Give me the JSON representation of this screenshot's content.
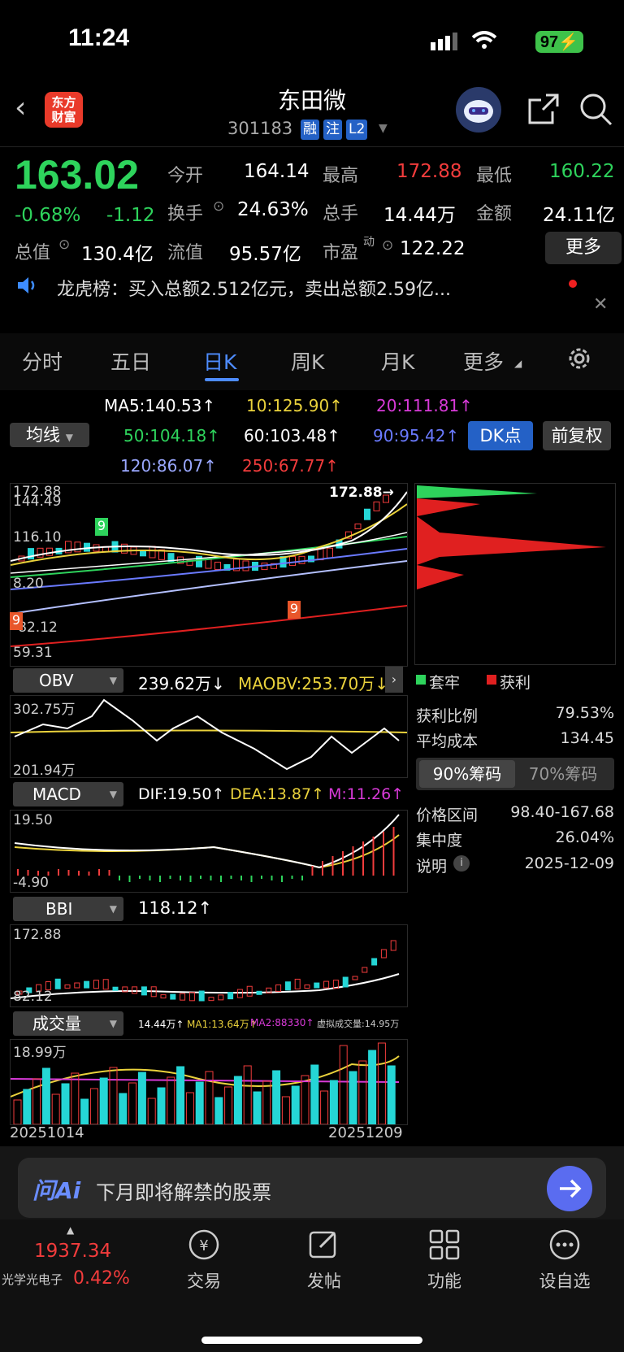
{
  "status": {
    "time": "11:24",
    "battery": "97"
  },
  "header": {
    "logo_line1": "东方",
    "logo_line2": "财富",
    "stock_name": "东田微",
    "code": "301183",
    "tags": [
      "融",
      "注",
      "L2"
    ]
  },
  "quote": {
    "price": "163.02",
    "pct": "-0.68%",
    "chg": "-1.12",
    "open_l": "今开",
    "open": "164.14",
    "high_l": "最高",
    "high": "172.88",
    "low_l": "最低",
    "low": "160.22",
    "turn_l": "换手",
    "turn": "24.63%",
    "vol_l": "总手",
    "vol": "14.44万",
    "amt_l": "金额",
    "amt": "24.11亿",
    "mcap_l": "总值",
    "mcap": "130.4亿",
    "fcap_l": "流值",
    "fcap": "95.57亿",
    "pe_l": "市盈",
    "pe_sup": "动",
    "pe": "122.22",
    "more": "更多"
  },
  "notice": {
    "text": "龙虎榜：买入总额2.512亿元，卖出总额2.59亿..."
  },
  "tabs": [
    "分时",
    "五日",
    "日K",
    "周K",
    "月K",
    "更多"
  ],
  "ma": {
    "selector": "均线",
    "ma5": "MA5:140.53↑",
    "ma10": "10:125.90↑",
    "ma20": "20:111.81↑",
    "ma50": "50:104.18↑",
    "ma60": "60:103.48↑",
    "ma90": "90:95.42↑",
    "ma120": "120:86.07↑",
    "ma250": "250:67.77↑",
    "dk": "DK点",
    "fq": "前复权"
  },
  "kline": {
    "y_max": "172.88",
    "y2": "144.49",
    "y3": "116.10",
    "y4": "8.20",
    "y5": "-82.12",
    "y6": "59.31",
    "high_mark": "172.88"
  },
  "obv": {
    "label": "OBV",
    "value": "239.62万↓",
    "ma": "MAOBV:253.70万↓",
    "y_top": "302.75万",
    "y_bot": "201.94万"
  },
  "macd": {
    "label": "MACD",
    "dif": "DIF:19.50↑",
    "dea": "DEA:13.87↑",
    "m": "M:11.26↑",
    "y_top": "19.50",
    "y_bot": "-4.90"
  },
  "bbi": {
    "label": "BBI",
    "value": "118.12↑",
    "y_top": "172.88",
    "y_bot": "82.12"
  },
  "volume": {
    "label": "成交量",
    "v": "14.44万↑",
    "ma1": "MA1:13.64万↑",
    "ma2": "MA2:88330↑",
    "virtual": "虚拟成交量:14.95万",
    "y_top": "18.99万",
    "date_l": "20251014",
    "date_r": "20251209"
  },
  "chips": {
    "legend1": "套牢",
    "legend2": "获利",
    "profit_l": "获利比例",
    "profit": "79.53%",
    "cost_l": "平均成本",
    "cost": "134.45",
    "tab90": "90%筹码",
    "tab70": "70%筹码",
    "range_l": "价格区间",
    "range": "98.40-167.68",
    "conc_l": "集中度",
    "conc": "26.04%",
    "note_l": "说明",
    "date": "2025-12-09"
  },
  "ai": {
    "brand": "问Ai",
    "text": "下月即将解禁的股票"
  },
  "bottom": {
    "index_value": "1937.34",
    "index_name": "光学光电子",
    "index_pct": "0.42%",
    "items": [
      "交易",
      "发帖",
      "功能",
      "设自选"
    ]
  }
}
